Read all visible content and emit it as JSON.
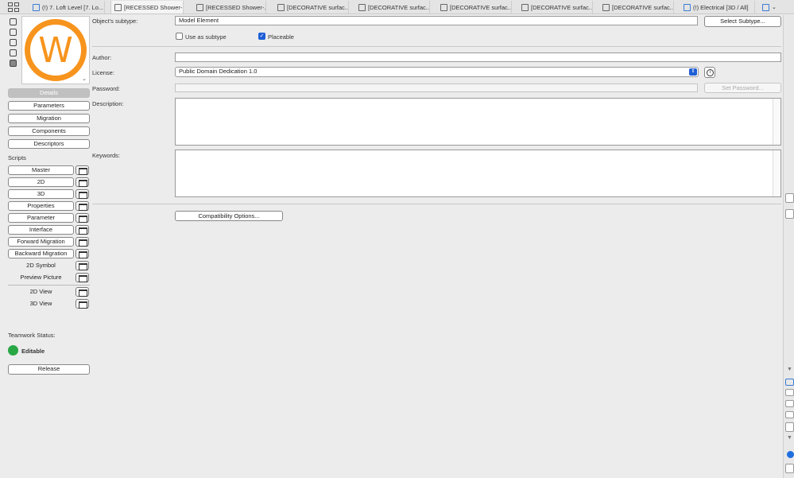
{
  "tabs": [
    {
      "label": "(!) 7. Loft Level [7. Lo...",
      "icon": "folder-plan-icon",
      "active": false
    },
    {
      "label": "[RECESSED Shower-...",
      "icon": "section-icon",
      "active": true
    },
    {
      "label": "[RECESSED Shower-...",
      "icon": "elevation-icon",
      "active": false
    },
    {
      "label": "[DECORATIVE surfac...",
      "icon": "section-icon",
      "active": false
    },
    {
      "label": "[DECORATIVE surfac...",
      "icon": "section-icon",
      "active": false
    },
    {
      "label": "[DECORATIVE surfac...",
      "icon": "elevation-icon",
      "active": false
    },
    {
      "label": "[DECORATIVE surfac...",
      "icon": "section-icon",
      "active": false
    },
    {
      "label": "[DECORATIVE surfac...",
      "icon": "elevation-icon",
      "active": false
    },
    {
      "label": "(!) Electrical [3D / All]",
      "icon": "3d-icon",
      "active": false
    }
  ],
  "preview": {
    "glyph": "W",
    "accent": "#f7941d"
  },
  "nav": {
    "details": "Details",
    "parameters": "Parameters",
    "migration": "Migration",
    "components": "Components",
    "descriptors": "Descriptors"
  },
  "scripts": {
    "heading": "Scripts",
    "items": [
      "Master",
      "2D",
      "3D",
      "Properties",
      "Parameter",
      "Interface",
      "Forward Migration",
      "Backward Migration",
      "2D Symbol",
      "Preview Picture"
    ],
    "views": [
      "2D View",
      "3D View"
    ]
  },
  "teamwork": {
    "heading": "Teamwork Status:",
    "status": "Editable",
    "status_color": "#28a745",
    "release_label": "Release"
  },
  "form": {
    "subtype_label": "Object's subtype:",
    "subtype_value": "Model Element",
    "select_subtype_label": "Select Subtype...",
    "use_as_subtype_label": "Use as subtype",
    "use_as_subtype_checked": false,
    "placeable_label": "Placeable",
    "placeable_checked": true,
    "author_label": "Author:",
    "author_value": "",
    "license_label": "License:",
    "license_value": "Public Domain Dedication 1.0",
    "password_label": "Password:",
    "password_value": "",
    "set_password_label": "Set Password...",
    "description_label": "Description:",
    "description_value": "",
    "keywords_label": "Keywords:",
    "keywords_value": "",
    "compat_label": "Compatibility Options..."
  },
  "colors": {
    "accent_blue": "#1f5fd6",
    "accent_orange": "#f7941d"
  }
}
